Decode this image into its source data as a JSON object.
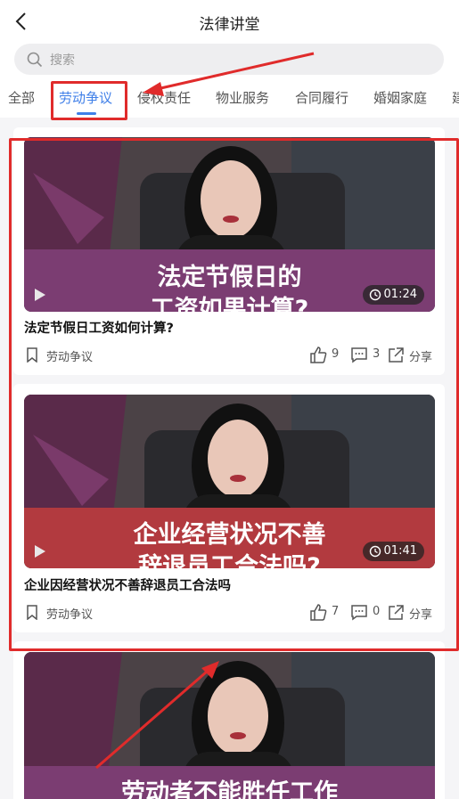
{
  "header": {
    "title": "法律讲堂"
  },
  "search": {
    "placeholder": "搜索"
  },
  "tabs": [
    {
      "label": "全部"
    },
    {
      "label": "劳动争议",
      "active": true
    },
    {
      "label": "侵权责任"
    },
    {
      "label": "物业服务"
    },
    {
      "label": "合同履行"
    },
    {
      "label": "婚姻家庭"
    },
    {
      "label": "建"
    }
  ],
  "videos": [
    {
      "caption": "法定节假日的\n工资如果计算?",
      "duration": "01:24",
      "title": "法定节假日工资如何计算?",
      "tag": "劳动争议",
      "likes": "9",
      "comments": "3",
      "share": "分享",
      "band_color": "#7b3d72"
    },
    {
      "caption": "企业经营状况不善\n辞退员工合法吗?",
      "duration": "01:41",
      "title": "企业因经营状况不善辞退员工合法吗",
      "tag": "劳动争议",
      "likes": "7",
      "comments": "0",
      "share": "分享",
      "band_color": "#b23a3f"
    },
    {
      "caption": "劳动者不能胜任工作",
      "band_color": "#7b3d72"
    }
  ],
  "colors": {
    "accent": "#3f7fe8",
    "annotation": "#e02b2b"
  }
}
